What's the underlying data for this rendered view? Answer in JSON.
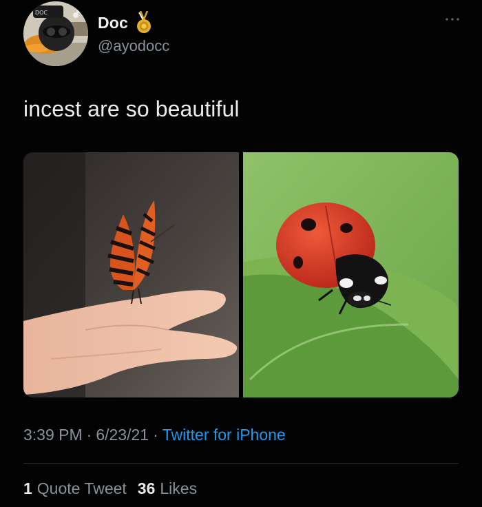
{
  "user": {
    "display_name": "Doc",
    "handle": "@ayodocc",
    "avatar_label": "DOC",
    "badge_icon": "medal-icon"
  },
  "tweet": {
    "text": "incest are so beautiful"
  },
  "media": {
    "left_image": "butterfly-on-hand",
    "right_image": "ladybug-on-leaf"
  },
  "meta": {
    "time": "3:39 PM",
    "date": "6/23/21",
    "source": "Twitter for iPhone",
    "separator": "·"
  },
  "stats": {
    "quote_count": "1",
    "quote_label": "Quote Tweet",
    "likes_count": "36",
    "likes_label": "Likes"
  },
  "colors": {
    "background": "#030303",
    "text": "#e7e9ea",
    "muted": "#8b9299",
    "link": "#1d9bf0"
  }
}
